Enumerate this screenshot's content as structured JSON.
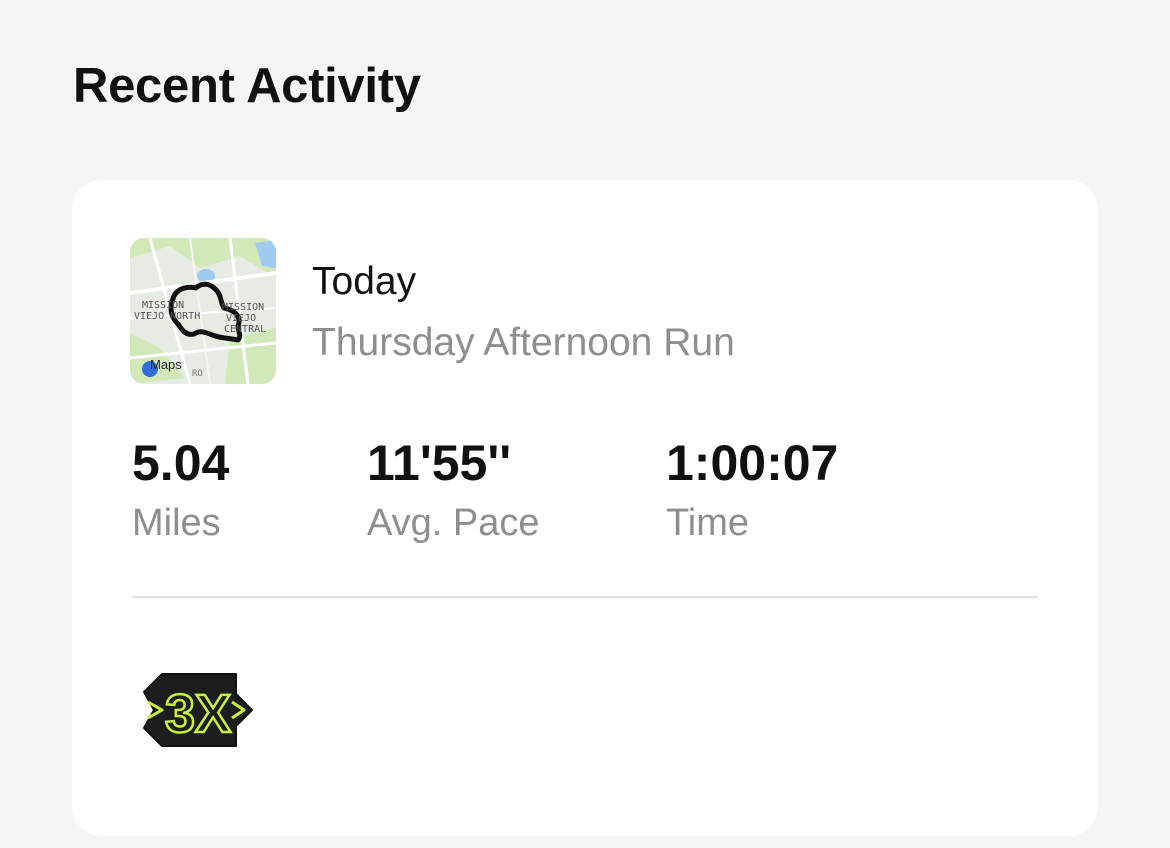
{
  "section": {
    "title": "Recent Activity"
  },
  "activity": {
    "date": "Today",
    "name": "Thursday Afternoon Run",
    "map": {
      "labels": [
        "MISSION",
        "VIEJO NORTH",
        "MISSION",
        "VIEJO",
        "CENTRAL"
      ],
      "attribution": "Maps",
      "road_label": "RO"
    },
    "stats": [
      {
        "value": "5.04",
        "label": "Miles"
      },
      {
        "value": "11'55''",
        "label": "Avg. Pace"
      },
      {
        "value": "1:00:07",
        "label": "Time"
      }
    ],
    "badge": {
      "text": "3X",
      "icon": "streak-badge-icon",
      "accent": "#c8f03c"
    }
  },
  "colors": {
    "background": "#f5f5f5",
    "card": "#ffffff",
    "primary_text": "#111111",
    "secondary_text": "#8e8e8e",
    "divider": "#e3e3e3"
  }
}
